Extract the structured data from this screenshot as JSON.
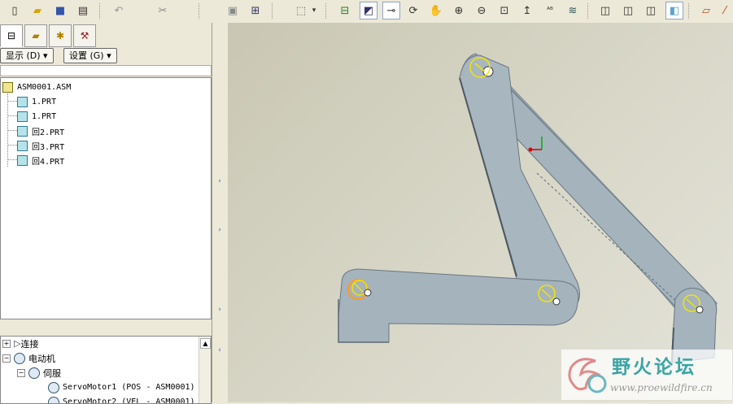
{
  "toolbar": {
    "icons": [
      "new-file",
      "open-folder",
      "save",
      "print",
      "undo",
      "cut",
      "paste",
      "regenerate",
      "select-box",
      "dropdown",
      "named-view",
      "orient",
      "csys-toggle",
      "spin-center",
      "pan",
      "zoom-in",
      "zoom-out",
      "refit",
      "repaint",
      "annotation",
      "layers",
      "wireframe",
      "hidden-line",
      "no-hidden",
      "shaded",
      "datum-plane",
      "datum-axis"
    ]
  },
  "left_panel": {
    "tabs": [
      "model-tree",
      "layer-tree",
      "favorites",
      "tools"
    ],
    "show_menu": "显示 (D) ▾",
    "settings_menu": "设置 (G) ▾",
    "tree": {
      "root": "ASM0001.ASM",
      "children": [
        "1.PRT",
        "1.PRT",
        "回2.PRT",
        "回3.PRT",
        "回4.PRT"
      ]
    },
    "lower_tree": [
      {
        "label": "连接",
        "expander": "+"
      },
      {
        "label": "电动机",
        "expander": "−"
      },
      {
        "label": "伺服",
        "expander": "−"
      },
      {
        "label": "ServoMotor1 (POS - ASM0001)",
        "expander": ""
      },
      {
        "label": "ServoMotor2 (VEL - ASM0001)",
        "expander": ""
      }
    ]
  },
  "watermark": {
    "title": "野火论坛",
    "url": "www.proewildfire.cn"
  },
  "colors": {
    "part": "#a5b3bd",
    "part_edge": "#5d6a73",
    "servo": "#f5e400",
    "csys_x": "#e00000",
    "csys_y": "#00b000"
  }
}
